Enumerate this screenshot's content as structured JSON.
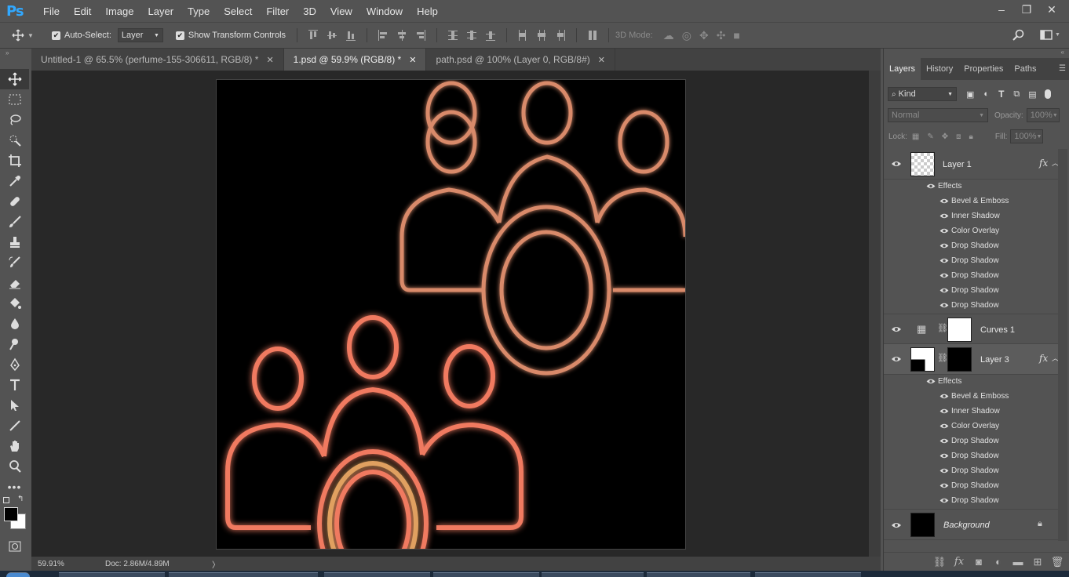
{
  "app": {
    "logo": "Ps"
  },
  "menu": [
    "File",
    "Edit",
    "Image",
    "Layer",
    "Type",
    "Select",
    "Filter",
    "3D",
    "View",
    "Window",
    "Help"
  ],
  "window_controls": {
    "minimize": "–",
    "restore": "❐",
    "close": "✕"
  },
  "options": {
    "auto_select_label": "Auto-Select:",
    "auto_select_value": "Layer",
    "show_transform_label": "Show Transform Controls",
    "mode_3d_label": "3D Mode:"
  },
  "tabs": [
    {
      "label": "Untitled-1 @ 65.5% (perfume-155-306611, RGB/8) *",
      "close": "✕"
    },
    {
      "label": "1.psd @ 59.9% (RGB/8) *",
      "close": "✕"
    },
    {
      "label": "path.psd @ 100% (Layer 0, RGB/8#)",
      "close": "✕"
    }
  ],
  "status": {
    "zoom": "59.91%",
    "doc": "Doc: 2.86M/4.89M",
    "arrow": "〉"
  },
  "panel_tabs": [
    "Layers",
    "History",
    "Properties",
    "Paths"
  ],
  "layers_panel": {
    "filter_kind": "Kind",
    "blend_mode": "Normal",
    "opacity_label": "Opacity:",
    "opacity_value": "100%",
    "lock_label": "Lock:",
    "fill_label": "Fill:",
    "fill_value": "100%"
  },
  "layers": [
    {
      "name": "Layer 1",
      "fx": "fx",
      "effects_label": "Effects",
      "effects": [
        "Bevel & Emboss",
        "Inner Shadow",
        "Color Overlay",
        "Drop Shadow",
        "Drop Shadow",
        "Drop Shadow",
        "Drop Shadow",
        "Drop Shadow"
      ]
    },
    {
      "name": "Curves 1"
    },
    {
      "name": "Layer 3",
      "fx": "fx",
      "effects_label": "Effects",
      "effects": [
        "Bevel & Emboss",
        "Inner Shadow",
        "Color Overlay",
        "Drop Shadow",
        "Drop Shadow",
        "Drop Shadow",
        "Drop Shadow",
        "Drop Shadow"
      ]
    },
    {
      "name": "Background"
    }
  ],
  "colors": {
    "accent": "#31a8ff",
    "upper_group_stroke": "#d98a6a",
    "lower_group_stroke": "#f07a60"
  }
}
